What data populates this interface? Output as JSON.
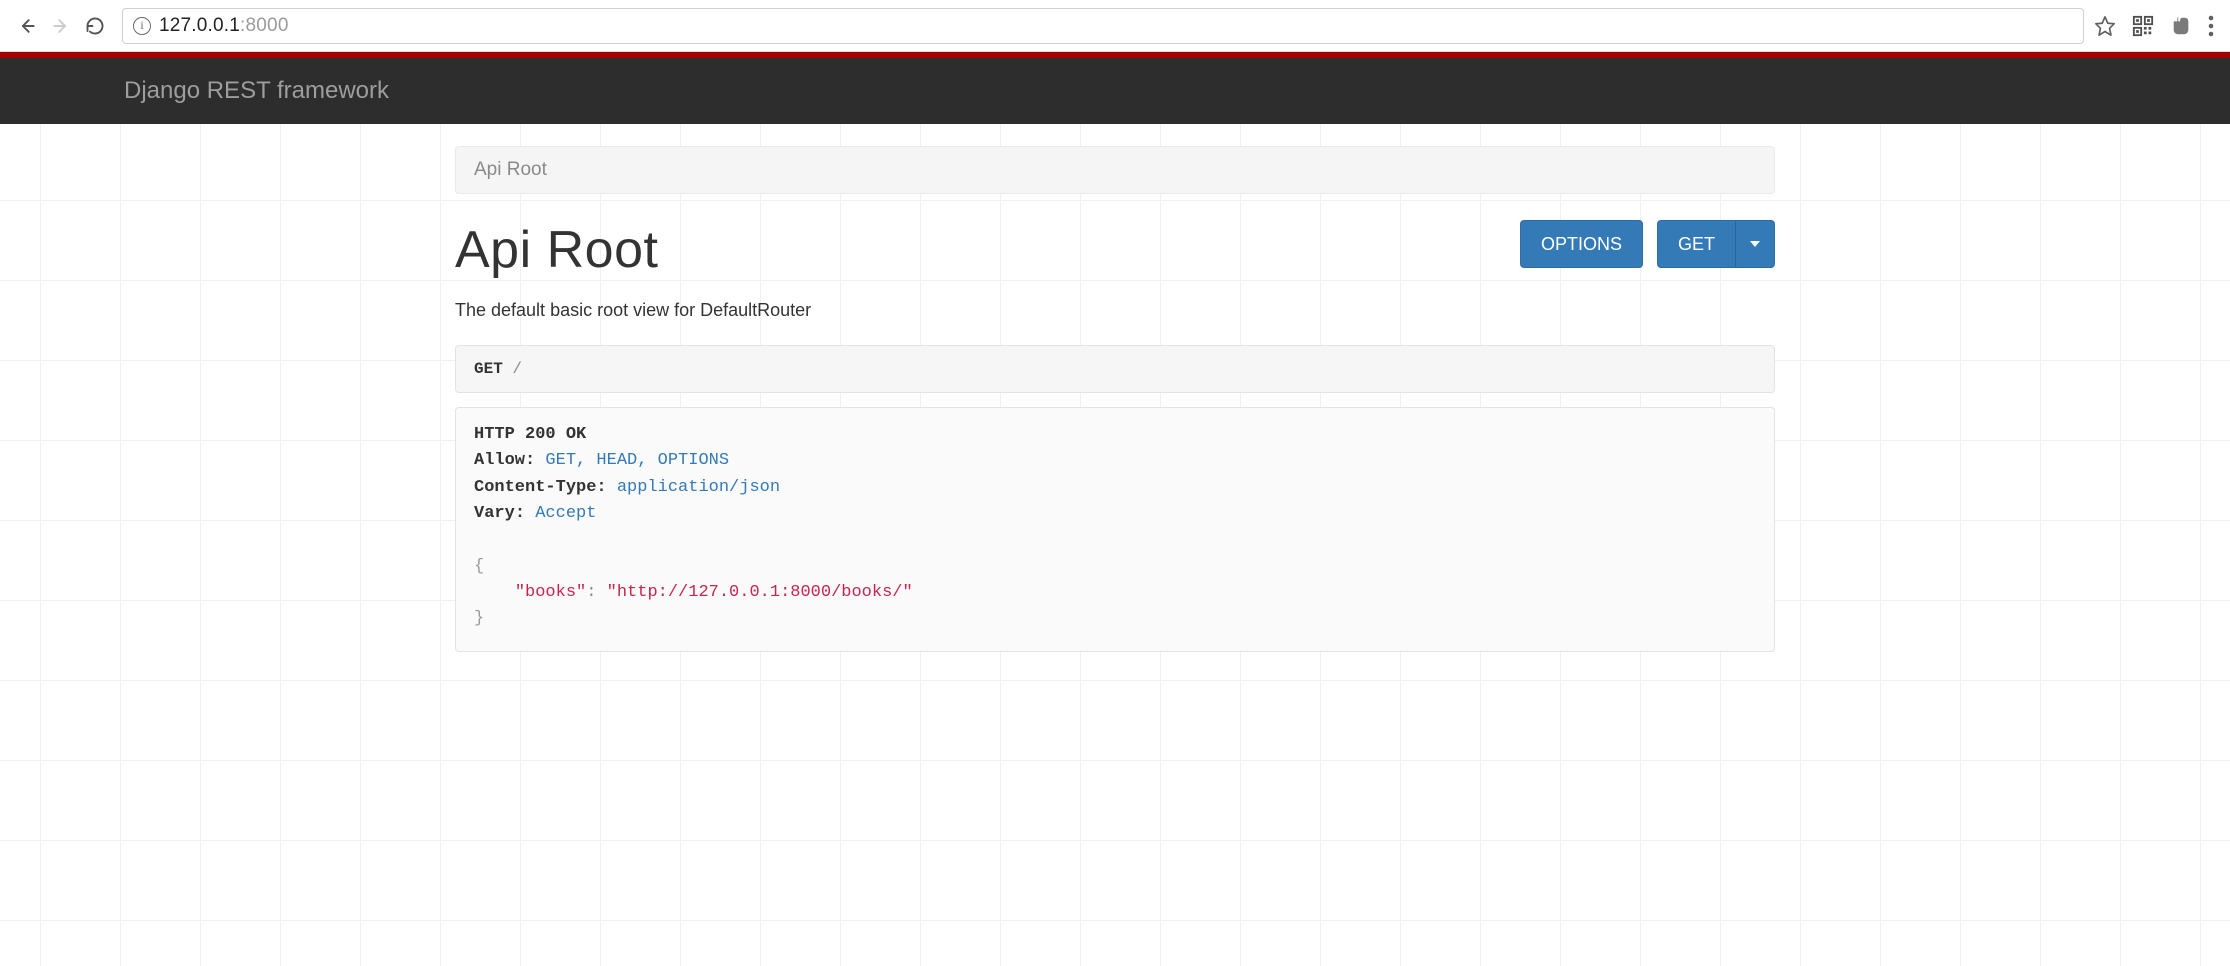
{
  "browser": {
    "url_host": "127.0.0.1",
    "url_port": ":8000"
  },
  "header": {
    "brand": "Django REST framework"
  },
  "breadcrumb": {
    "items": [
      "Api Root"
    ]
  },
  "page": {
    "title": "Api Root",
    "description": "The default basic root view for DefaultRouter"
  },
  "buttons": {
    "options": "OPTIONS",
    "get": "GET"
  },
  "request": {
    "method": "GET",
    "path": "/"
  },
  "response": {
    "status_line": "HTTP 200 OK",
    "headers": [
      {
        "name": "Allow",
        "value": "GET, HEAD, OPTIONS"
      },
      {
        "name": "Content-Type",
        "value": "application/json"
      },
      {
        "name": "Vary",
        "value": "Accept"
      }
    ],
    "body_key": "\"books\"",
    "body_value": "\"http://127.0.0.1:8000/books/\""
  }
}
